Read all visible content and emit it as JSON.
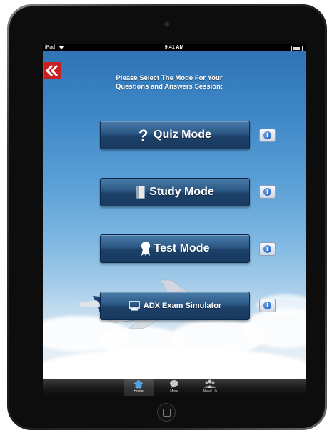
{
  "statusbar": {
    "carrier": "iPad",
    "time": "9:41 AM",
    "battery_level": 0.8
  },
  "instructions": {
    "line1": "Please Select The Mode For Your",
    "line2": "Questions and Answers Session:"
  },
  "modes": [
    {
      "label": "Quiz Mode",
      "icon": "question-mark-icon"
    },
    {
      "label": "Study Mode",
      "icon": "book-icon"
    },
    {
      "label": "Test Mode",
      "icon": "ribbon-award-icon"
    },
    {
      "label": "ADX Exam Simulator",
      "icon": "computer-monitor-icon"
    }
  ],
  "info_button_icon": "info-icon",
  "info_glyph": "i",
  "back_icon": "double-chevron-left-icon",
  "tabbar": {
    "items": [
      {
        "label": "Home",
        "icon": "home-icon",
        "active": true
      },
      {
        "label": "More",
        "icon": "speech-bubble-icon",
        "active": false
      },
      {
        "label": "About Us",
        "icon": "people-icon",
        "active": false
      }
    ]
  },
  "colors": {
    "accent_red": "#c8201e",
    "button_blue": "#2b5783",
    "sky_top": "#2f74b4"
  }
}
